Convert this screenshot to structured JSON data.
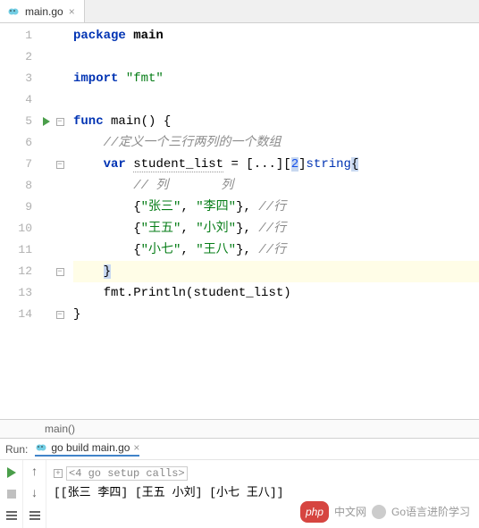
{
  "tab": {
    "filename": "main.go",
    "close": "×"
  },
  "gutter": [
    "1",
    "2",
    "3",
    "4",
    "5",
    "6",
    "7",
    "8",
    "9",
    "10",
    "11",
    "12",
    "13",
    "14"
  ],
  "code": {
    "kw_package": "package",
    "pkg_main": "main",
    "kw_import": "import",
    "str_fmt": "\"fmt\"",
    "kw_func": "func",
    "fn_main": "main",
    "cmt_def": "//定义一个三行两列的一个数组",
    "kw_var": "var",
    "ident_student": "student_list",
    "ellipsis": "...",
    "num_2": "2",
    "type_string": "string",
    "cmt_col": "// 列       列",
    "str_zs": "\"张三\"",
    "str_ls": "\"李四\"",
    "cmt_row": "//行",
    "str_ww": "\"王五\"",
    "str_xl": "\"小刘\"",
    "str_xq": "\"小七\"",
    "str_wb": "\"王八\"",
    "fmt_println": "fmt.Println",
    "arg_student": "student_list"
  },
  "breadcrumb": "main()",
  "run": {
    "label": "Run:",
    "config": "go build main.go",
    "close": "×",
    "fold": "<4 go setup calls>",
    "output": "[[张三 李四] [王五 小刘] [小七 王八]]"
  },
  "watermark": {
    "php": "php",
    "php_cn": "中文网",
    "go": "Go语言进阶学习"
  }
}
